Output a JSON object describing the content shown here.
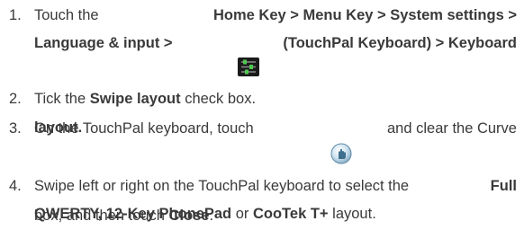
{
  "steps": [
    {
      "number": "1.",
      "line1": {
        "a": "Touch the",
        "b": "Home Key > Menu Key > System settings >"
      },
      "line2": {
        "a": "Language & input >",
        "b": "(TouchPal Keyboard) > Keyboard"
      },
      "line3": "layout."
    },
    {
      "number": "2.",
      "pre": "Tick the ",
      "bold": "Swipe layout",
      "post": " check box."
    },
    {
      "number": "3.",
      "line1": {
        "a": "On the TouchPal keyboard, touch",
        "b": "and clear the Curve"
      },
      "line2": {
        "a": "box, and then touch ",
        "b": "Close",
        "c": "."
      }
    },
    {
      "number": "4.",
      "line1": {
        "a": "Swipe left or right on the TouchPal keyboard to select the",
        "b": "Full"
      },
      "line2": {
        "a": "QWERTY, 12-Key PhonePad",
        "b": " or ",
        "c": "CooTek T+",
        "d": " layout."
      }
    }
  ],
  "icons": {
    "settings": "settings-sliders-icon",
    "touchpal": "touchpal-hand-icon"
  }
}
